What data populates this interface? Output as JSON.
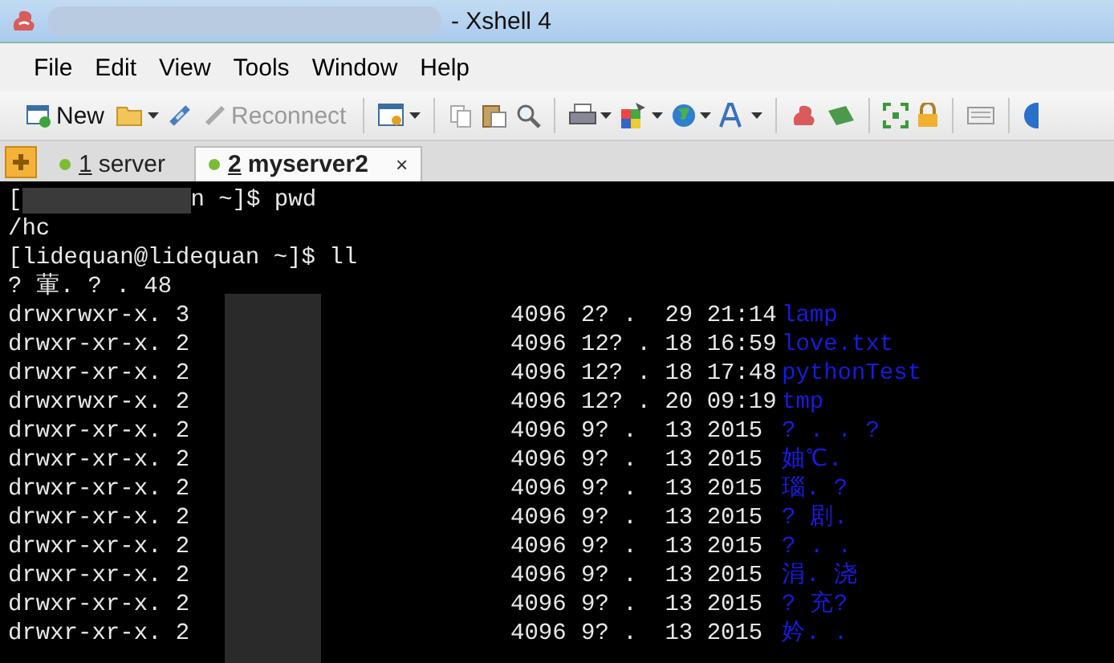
{
  "window": {
    "title": "- Xshell 4"
  },
  "menu": [
    "File",
    "Edit",
    "View",
    "Tools",
    "Window",
    "Help"
  ],
  "toolbar": {
    "new": "New",
    "reconnect": "Reconnect"
  },
  "tabs": [
    {
      "number": "1",
      "label": "server",
      "selected": false
    },
    {
      "number": "2",
      "label": "myserver2",
      "selected": true,
      "close": "×"
    }
  ],
  "terminal": {
    "lines": [
      {
        "kind": "text",
        "text": "[",
        "tail": "n ~]$ pwd"
      },
      {
        "kind": "text",
        "text": "/hc"
      },
      {
        "kind": "text",
        "text": "[lidequan@lidequan ~]$ ll"
      },
      {
        "kind": "text",
        "text": "? 葷. ? . 48"
      }
    ],
    "entries": [
      {
        "perms": "drwxrwxr-x. 3",
        "size": "4096",
        "date": "2? .  29 21:14",
        "name": "lamp"
      },
      {
        "perms": "drwxr-xr-x. 2",
        "size": "4096",
        "date": "12? . 18 16:59",
        "name": "love.txt"
      },
      {
        "perms": "drwxr-xr-x. 2",
        "size": "4096",
        "date": "12? . 18 17:48",
        "name": "pythonTest"
      },
      {
        "perms": "drwxrwxr-x. 2",
        "size": "4096",
        "date": "12? . 20 09:19",
        "name": "tmp"
      },
      {
        "perms": "drwxr-xr-x. 2",
        "size": "4096",
        "date": "9? .  13 2015",
        "name": "? . . ?"
      },
      {
        "perms": "drwxr-xr-x. 2",
        "size": "4096",
        "date": "9? .  13 2015",
        "name": "妯℃."
      },
      {
        "perms": "drwxr-xr-x. 2",
        "size": "4096",
        "date": "9? .  13 2015",
        "name": "瑙. ?"
      },
      {
        "perms": "drwxr-xr-x. 2",
        "size": "4096",
        "date": "9? .  13 2015",
        "name": "? 剧."
      },
      {
        "perms": "drwxr-xr-x. 2",
        "size": "4096",
        "date": "9? .  13 2015",
        "name": "? . ."
      },
      {
        "perms": "drwxr-xr-x. 2",
        "size": "4096",
        "date": "9? .  13 2015",
        "name": "涓. 浇"
      },
      {
        "perms": "drwxr-xr-x. 2",
        "size": "4096",
        "date": "9? .  13 2015",
        "name": "? 充?"
      },
      {
        "perms": "drwxr-xr-x. 2",
        "size": "4096",
        "date": "9? .  13 2015",
        "name": "妗. ."
      }
    ]
  }
}
